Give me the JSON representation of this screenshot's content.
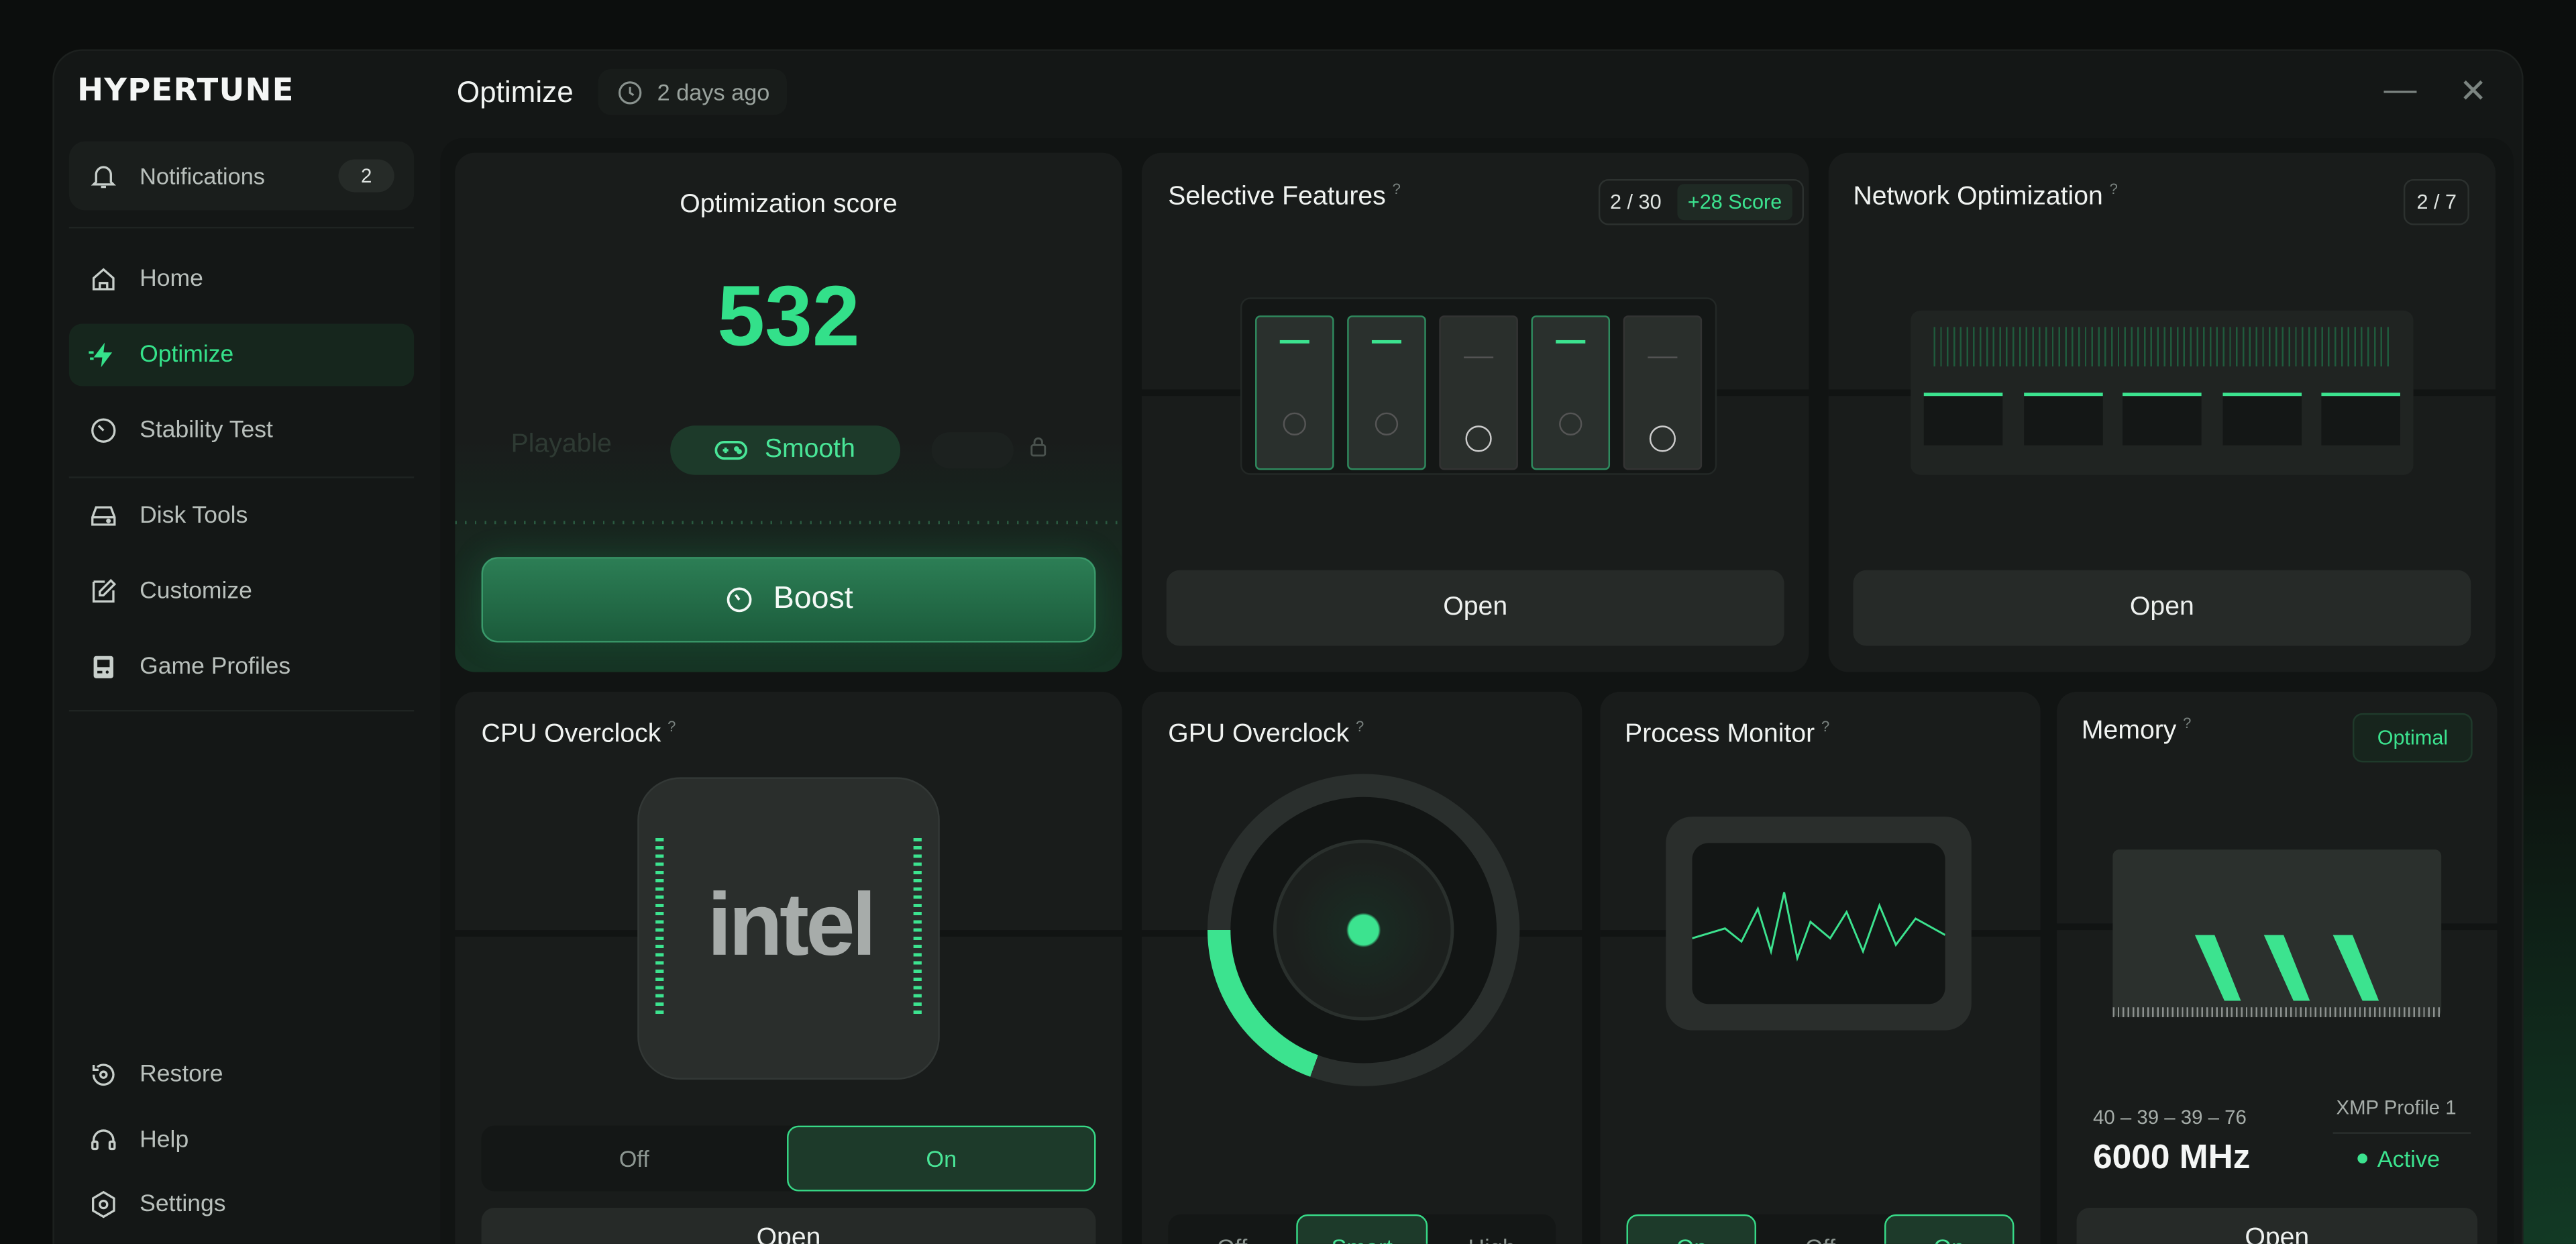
{
  "app": {
    "name": "HYPERTUNE"
  },
  "sidebar": {
    "notifications": {
      "label": "Notifications",
      "count": "2"
    },
    "items": [
      {
        "label": "Home",
        "icon": "home-icon"
      },
      {
        "label": "Optimize",
        "icon": "bolt-icon"
      },
      {
        "label": "Stability Test",
        "icon": "gauge-icon"
      },
      {
        "label": "Disk Tools",
        "icon": "disk-icon"
      },
      {
        "label": "Customize",
        "icon": "edit-icon"
      },
      {
        "label": "Game Profiles",
        "icon": "gamepad-icon"
      }
    ],
    "footer": [
      {
        "label": "Restore",
        "icon": "restore-icon"
      },
      {
        "label": "Help",
        "icon": "headset-icon"
      },
      {
        "label": "Settings",
        "icon": "gear-icon"
      }
    ]
  },
  "header": {
    "title": "Optimize",
    "last_run": "2 days ago"
  },
  "score_card": {
    "title": "Optimization score",
    "score": "532",
    "levels": [
      "Playable",
      "Smooth"
    ],
    "active_level": "Smooth",
    "boost_label": "Boost"
  },
  "selective_features": {
    "title": "Selective Features",
    "count": "2 / 30",
    "score_bonus": "+28 Score",
    "open_label": "Open"
  },
  "network": {
    "title": "Network Optimization",
    "count": "2 / 7",
    "open_label": "Open"
  },
  "cpu": {
    "title": "CPU Overclock",
    "brand": "intel",
    "toggle": {
      "off": "Off",
      "on": "On",
      "state": "on"
    },
    "open_label": "Open"
  },
  "gpu": {
    "title": "GPU Overclock",
    "options": [
      "Off",
      "Smart",
      "High"
    ],
    "selected": "Smart"
  },
  "process": {
    "title": "Process Monitor",
    "options": [
      "On",
      "Off",
      "On"
    ]
  },
  "memory": {
    "title": "Memory",
    "status": "Optimal",
    "timings": "40 – 39 – 39 – 76",
    "speed": "6000 MHz",
    "xmp_label": "XMP Profile 1",
    "xmp_status": "Active",
    "open_label": "Open"
  },
  "colors": {
    "accent": "#35e28a",
    "background": "#111413",
    "card": "#191c1b"
  }
}
